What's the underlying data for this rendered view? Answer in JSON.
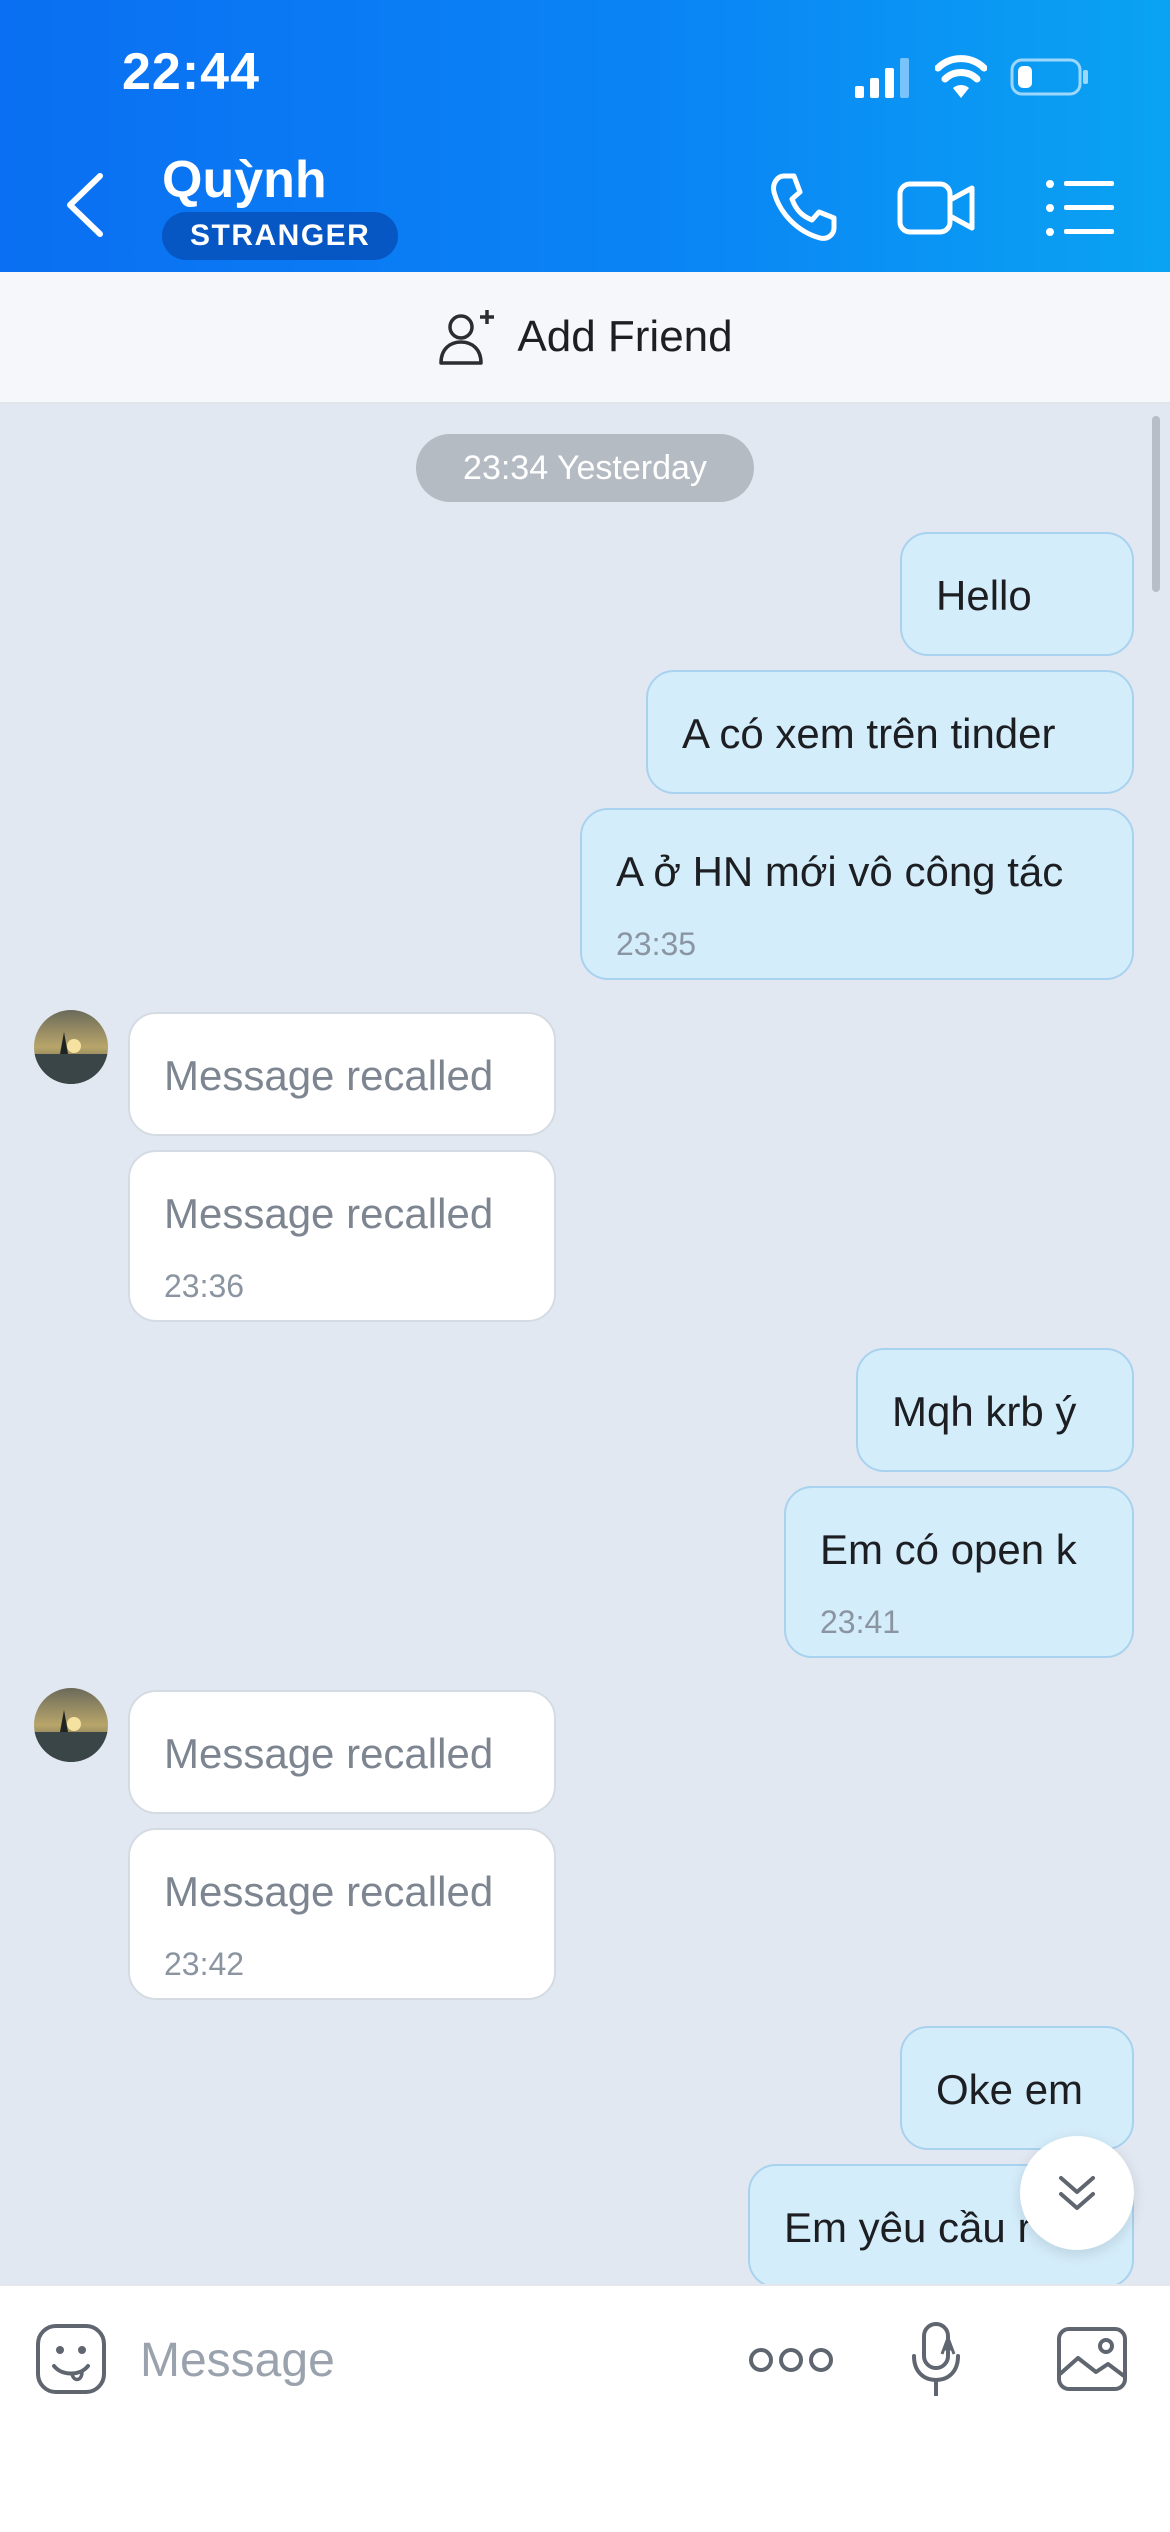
{
  "status_bar": {
    "time": "22:44"
  },
  "header": {
    "contact_name": "Quỳnh",
    "badge": "STRANGER",
    "icons": [
      "back-icon",
      "phone-icon",
      "video-call-icon",
      "menu-icon"
    ]
  },
  "add_friend": {
    "label": "Add Friend",
    "icon": "add-person-icon"
  },
  "chat": {
    "date_divider": "23:34 Yesterday",
    "messages": [
      {
        "dir": "out",
        "text": "Hello"
      },
      {
        "dir": "out",
        "text": "A có xem trên tinder"
      },
      {
        "dir": "out",
        "text": "A ở HN mới vô công tác",
        "time": "23:35"
      },
      {
        "dir": "in",
        "text": "Message recalled"
      },
      {
        "dir": "in",
        "text": "Message recalled",
        "time": "23:36"
      },
      {
        "dir": "out",
        "text": "Mqh krb ý"
      },
      {
        "dir": "out",
        "text": "Em có open k",
        "time": "23:41"
      },
      {
        "dir": "in",
        "text": "Message recalled"
      },
      {
        "dir": "in",
        "text": "Message recalled",
        "time": "23:42"
      },
      {
        "dir": "out",
        "text": "Oke em"
      },
      {
        "dir": "out",
        "text": "Em yêu cầu r"
      }
    ]
  },
  "input_bar": {
    "placeholder": "Message"
  },
  "colors": {
    "header_start": "#0a6ff2",
    "header_end": "#0aa3f2",
    "chat_bg": "#e2e8f1",
    "outgoing_bubble": "#d4edfb",
    "incoming_bubble": "#ffffff"
  }
}
